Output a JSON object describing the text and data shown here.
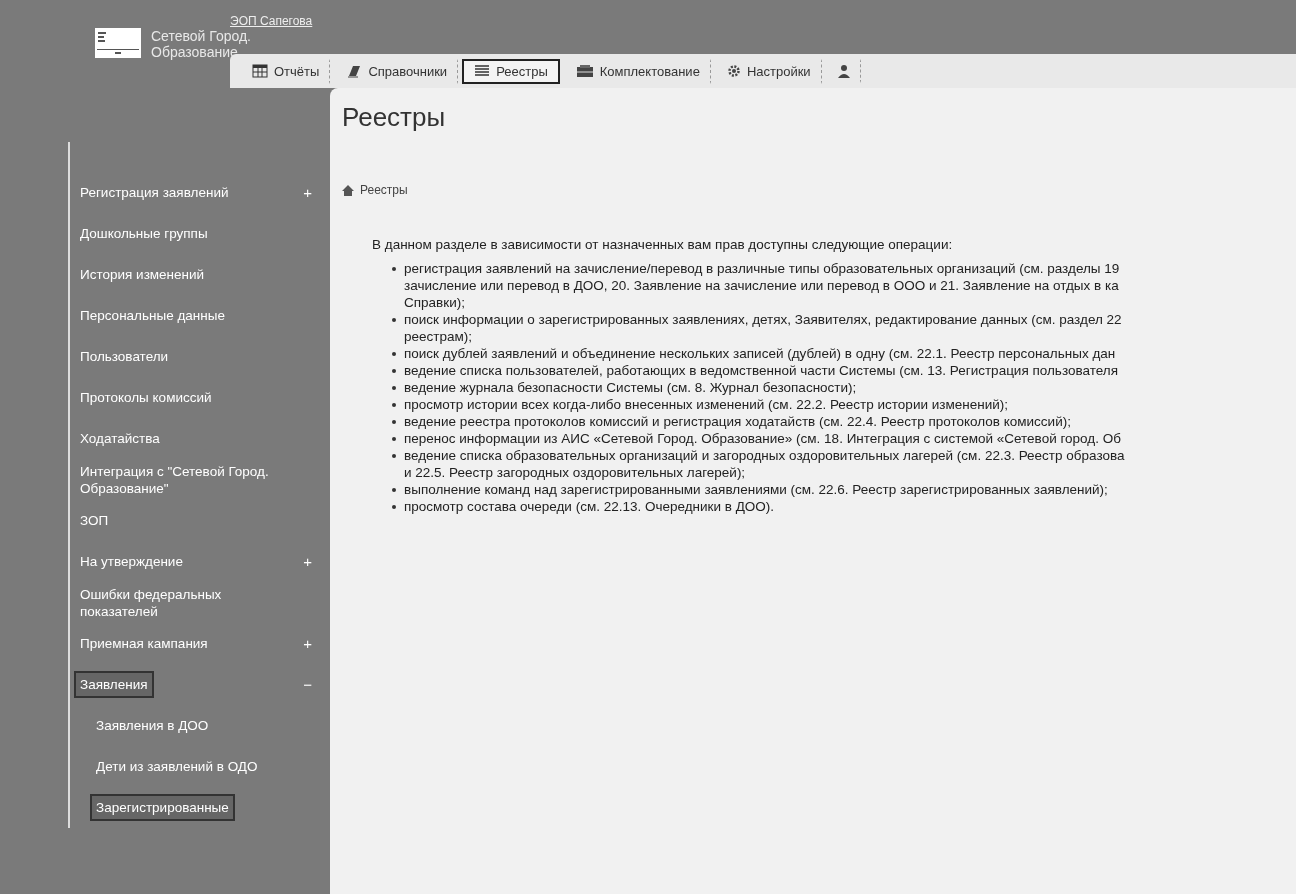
{
  "header": {
    "logo_lines": [
      "Сетевой Город.",
      "Образование"
    ],
    "user": "ЭОП Сапегова"
  },
  "tabs": [
    {
      "label": "Отчёты",
      "selected": false
    },
    {
      "label": "Справочники",
      "selected": false
    },
    {
      "label": "Реестры",
      "selected": true
    },
    {
      "label": "Комплектование",
      "selected": false
    },
    {
      "label": "Настройки",
      "selected": false
    },
    {
      "selected": false
    }
  ],
  "sidebar": {
    "items": [
      {
        "label": "Регистрация заявлений",
        "expander": "+",
        "selected": false
      },
      {
        "label": "Дошкольные группы",
        "selected": false
      },
      {
        "label": "История изменений",
        "selected": false
      },
      {
        "label": "Персональные данные",
        "selected": false
      },
      {
        "label": "Пользователи",
        "selected": false
      },
      {
        "label": "Протоколы комиссий",
        "selected": false
      },
      {
        "label": "Ходатайства",
        "selected": false
      },
      {
        "label": "Интеграция с \"Сетевой Город. Образование\"",
        "selected": false
      },
      {
        "label": "ЗОП",
        "selected": false
      },
      {
        "label": "На утверждение",
        "expander": "+",
        "selected": false
      },
      {
        "label": "Ошибки федеральных показателей",
        "selected": false
      },
      {
        "label": "Приемная кампания",
        "expander": "+",
        "selected": false
      },
      {
        "label": "Заявления",
        "expander": "−",
        "selected": true,
        "children": [
          {
            "label": "Заявления в ДОО",
            "selected": false
          },
          {
            "label": "Дети из заявлений в ОДО",
            "selected": false
          },
          {
            "label": "Зарегистрированные",
            "selected": true
          }
        ]
      }
    ]
  },
  "content": {
    "title": "Реестры",
    "breadcrumb": "Реестры",
    "intro": "В данном разделе в зависимости от назначенных вам прав доступны следующие операции:",
    "bullets": [
      [
        "регистрация заявлений на зачисление/перевод в различные типы образовательных организаций (см. разделы 19",
        "зачисление или перевод в ДОО, 20. Заявление на зачисление или перевод в ООО и 21. Заявление на отдых в ка",
        "Справки);"
      ],
      [
        "поиск информации о зарегистрированных заявлениях, детях, Заявителях, редактирование данных (см. раздел 22",
        "реестрам);"
      ],
      [
        "поиск дублей заявлений и объединение нескольких записей (дублей) в одну (см. 22.1. Реестр персональных дан"
      ],
      [
        "ведение списка пользователей, работающих в ведомственной части Системы (см. 13. Регистрация пользователя"
      ],
      [
        "ведение журнала безопасности Системы (см. 8. Журнал безопасности);"
      ],
      [
        "просмотр истории всех когда-либо внесенных изменений (см. 22.2. Реестр истории изменений);"
      ],
      [
        "ведение реестра протоколов комиссий и регистрация ходатайств (см. 22.4. Реестр протоколов комиссий);"
      ],
      [
        "перенос информации из АИС «Сетевой Город. Образование» (см. 18. Интеграция с системой «Сетевой город. Об"
      ],
      [
        "ведение списка образовательных организаций и загородных оздоровительных лагерей (см. 22.3. Реестр образова",
        "и 22.5. Реестр загородных оздоровительных лагерей);"
      ],
      [
        "выполнение команд над зарегистрированными заявлениями (см. 22.6. Реестр зарегистрированных заявлений);"
      ],
      [
        "просмотр состава очереди (см. 22.13. Очередники в ДОО)."
      ]
    ]
  }
}
